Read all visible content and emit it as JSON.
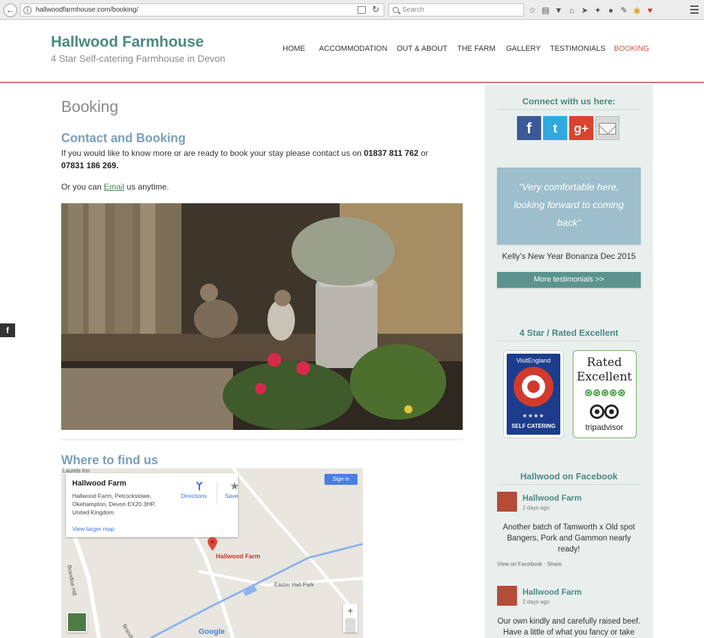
{
  "browser": {
    "url": "hallwoodfarmhouse.com/booking/",
    "search_placeholder": "Search"
  },
  "site": {
    "title": "Hallwood Farmhouse",
    "tagline": "4 Star Self-catering Farmhouse in Devon"
  },
  "nav": {
    "items": [
      {
        "label": "HOME"
      },
      {
        "label": "ACCOMMODATION"
      },
      {
        "label": "OUT & ABOUT"
      },
      {
        "label": "THE FARM"
      },
      {
        "label": "GALLERY"
      },
      {
        "label": "TESTIMONIALS"
      },
      {
        "label": "BOOKING"
      }
    ],
    "active": "BOOKING"
  },
  "float_social": "f",
  "main": {
    "page_title": "Booking",
    "contact_heading": "Contact and Booking",
    "contact_text_1": "If you would like to know more or are ready to book your stay please contact us on",
    "phone_1": "01837 811 762",
    "or": "or",
    "phone_2": "07831 186 269.",
    "email_text_before": "Or you can",
    "email_link": "Email",
    "email_text_after": "us anytime.",
    "find_heading": "Where to find us"
  },
  "map": {
    "place_name": "Hallwood Farm",
    "address": "Hallwood Farm, Petrockstowe, Okehampton, Devon EX20 3HP, United Kingdom",
    "directions": "Directions",
    "save": "Save",
    "larger_map": "View larger map",
    "sign_in": "Sign in",
    "pin_label": "Hallwood Farm",
    "label_laurels": "Laurels Inn",
    "label_easter_hall": "Easter Hall Park",
    "label_road_1": "Brandise Hill",
    "label_road_2": "Brandis",
    "zoom_in": "+",
    "zoom_out": "−",
    "google": "Google"
  },
  "sidebar": {
    "connect_heading": "Connect with us here:",
    "social": {
      "facebook": "f",
      "twitter": "t",
      "gplus": "g+"
    },
    "quote": "“Very comfortable here, looking forward to coming back”",
    "quote_author": "Kelly's New Year Bonanza Dec 2015",
    "more_testimonials": "More testimonials >>",
    "rated_heading": "4 Star / Rated Excellent",
    "visit_england": "VisitEngland",
    "ve_stars": "★★★★",
    "ve_label": "SELF CATERING",
    "ta_rated": "Rated Excellent",
    "ta_name": "tripadvisor",
    "fb_heading": "Hallwood on Facebook",
    "posts": [
      {
        "name": "Hallwood Farm",
        "time": "2 days ago",
        "text": "Another batch of Tamworth x Old spot Bangers, Pork and Gammon nearly ready!",
        "links": "View on Facebook · Share"
      },
      {
        "name": "Hallwood Farm",
        "time": "2 days ago",
        "text": "Our own kindly and carefully raised beef. Have a little of what you fancy or take"
      }
    ]
  }
}
